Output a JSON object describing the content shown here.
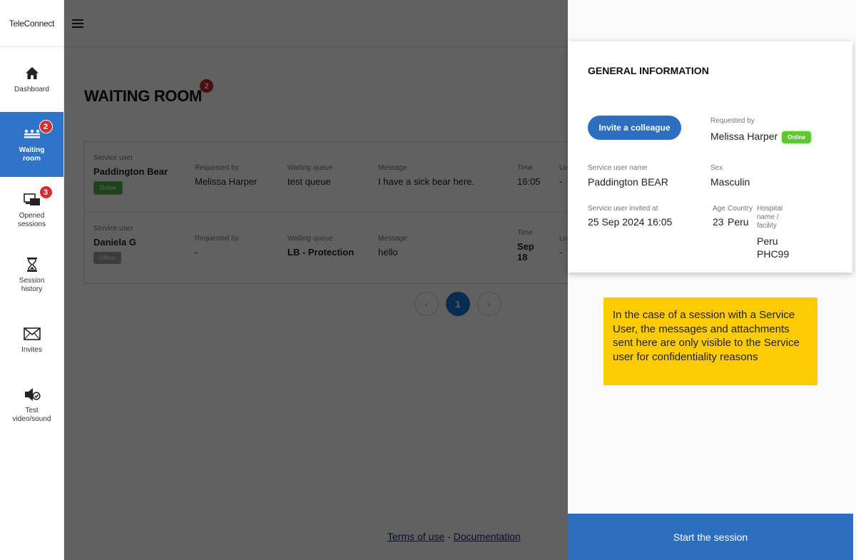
{
  "app": {
    "brand": "TeleConnect"
  },
  "sidebar": {
    "items": [
      {
        "label": "Dashboard",
        "icon": "home-icon"
      },
      {
        "label": "Waiting room",
        "icon": "waiting-room-icon",
        "badge": "2",
        "active": true
      },
      {
        "label": "Opened sessions",
        "icon": "sessions-icon",
        "badge": "3"
      },
      {
        "label": "Session history",
        "icon": "hourglass-icon"
      },
      {
        "label": "Invites",
        "icon": "mail-icon"
      },
      {
        "label": "Test video/sound",
        "icon": "speaker-check-icon"
      }
    ]
  },
  "main": {
    "title": "WAITING ROOM",
    "title_badge": "2",
    "queue": [
      {
        "service_user_label": "Service user",
        "service_user": "Paddington Bear",
        "status": "Online",
        "requested_by_label": "Requested by",
        "requested_by": "Melissa Harper",
        "queue_label": "Waiting queue",
        "queue": "test queue",
        "message_label": "Message",
        "message": "I have a sick bear here.",
        "time_label": "Time",
        "time": "16:05",
        "lo_label": "Lo",
        "lo": "-"
      },
      {
        "service_user_label": "Service user",
        "service_user": "Daniela G",
        "status": "Offline",
        "requested_by_label": "Requested by",
        "requested_by": "-",
        "queue_label": "Waiting queue",
        "queue": "LB - Protection",
        "message_label": "Message",
        "message": "hello",
        "time_label": "Time",
        "time_line1": "Sep",
        "time_line2": "18",
        "lo_label": "Lo",
        "lo": "-"
      }
    ],
    "pagination": {
      "prev": "‹",
      "current": "1",
      "next": "›"
    },
    "footer": {
      "terms": "Terms of use",
      "separator": " - ",
      "docs": "Documentation"
    }
  },
  "panel": {
    "title": "GENERAL INFORMATION",
    "invite_button": "Invite a colleague",
    "requested_by_label": "Requested by",
    "requested_by": "Melissa Harper",
    "requested_by_status": "Online",
    "service_user_name_label": "Service user name",
    "service_user_name": "Paddington BEAR",
    "sex_label": "Sex",
    "sex": "Masculin",
    "invited_at_label": "Service user invited at",
    "invited_at": "25 Sep 2024 16:05",
    "age_label": "Age",
    "age": "23",
    "country_label": "Country",
    "country": "Peru",
    "hospital_label_1": "Hospital",
    "hospital_label_2": "name /",
    "hospital_label_3": "facility",
    "hospital_line1": "Peru",
    "hospital_line2": "PHC99",
    "notice": "In the case of a session with a Service User, the messages and attachments sent here are only visible to the Service user for confidentiality reasons",
    "start_button": "Start the session"
  },
  "colors": {
    "primary": "#2c6fbf",
    "badge": "#d32f2f",
    "notice": "#ffcb05",
    "online": "#61c534"
  }
}
